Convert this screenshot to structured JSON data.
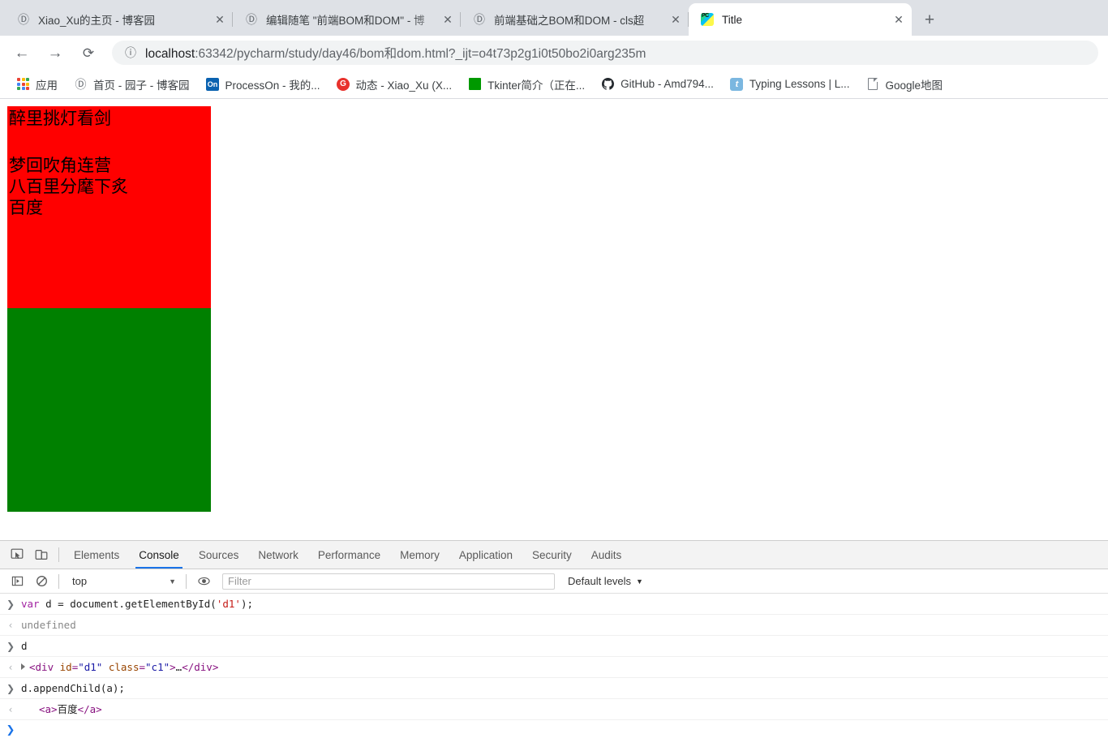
{
  "browser": {
    "tabs": [
      {
        "title": "Xiao_Xu的主页 - 博客园",
        "icon": "blogger-icon",
        "active": false,
        "close_label": "✕"
      },
      {
        "title": "编辑随笔 \"前端BOM和DOM\" - 博",
        "icon": "blogger-icon",
        "active": false,
        "close_label": "✕"
      },
      {
        "title": "前端基础之BOM和DOM - cls超",
        "icon": "blogger-icon",
        "active": false,
        "close_label": "✕"
      },
      {
        "title": "Title",
        "icon": "pycharm-icon",
        "active": true,
        "close_label": "✕"
      }
    ],
    "new_tab_label": "+",
    "nav": {
      "back_label": "←",
      "forward_label": "→",
      "reload_label": "⟳",
      "info_label": "ⓘ"
    },
    "address": {
      "host": "localhost",
      "rest": ":63342/pycharm/study/day46/bom和dom.html?_ijt=o4t73p2g1i0t50bo2i0arg235m",
      "full": "localhost:63342/pycharm/study/day46/bom和dom.html?_ijt=o4t73p2g1i0t50bo2i0arg235m"
    },
    "bookmarks": [
      {
        "label": "应用",
        "icon": "apps-grid-icon"
      },
      {
        "label": "首页 - 园子 - 博客园",
        "icon": "blogger-icon"
      },
      {
        "label": "ProcessOn - 我的...",
        "icon": "processon-icon"
      },
      {
        "label": "动态 - Xiao_Xu (X...",
        "icon": "gitee-icon"
      },
      {
        "label": "Tkinter简介（正在...",
        "icon": "green-square-icon"
      },
      {
        "label": "GitHub - Amd794...",
        "icon": "github-icon"
      },
      {
        "label": "Typing Lessons | L...",
        "icon": "typing-icon"
      },
      {
        "label": "Google地图",
        "icon": "document-icon"
      }
    ]
  },
  "page": {
    "red_div": {
      "id": "d1",
      "class": "c1",
      "color": "#ff0000",
      "title_line": "醉里挑灯看剑",
      "line2": "梦回吹角连营",
      "line3": "八百里分麾下炙",
      "appended_link_text": "百度"
    },
    "green_div": {
      "color": "#008000"
    }
  },
  "devtools": {
    "toolbar_icons": [
      {
        "name": "inspect-element-icon"
      },
      {
        "name": "device-toolbar-icon"
      }
    ],
    "tabs": [
      {
        "label": "Elements",
        "active": false
      },
      {
        "label": "Console",
        "active": true
      },
      {
        "label": "Sources",
        "active": false
      },
      {
        "label": "Network",
        "active": false
      },
      {
        "label": "Performance",
        "active": false
      },
      {
        "label": "Memory",
        "active": false
      },
      {
        "label": "Application",
        "active": false
      },
      {
        "label": "Security",
        "active": false
      },
      {
        "label": "Audits",
        "active": false
      }
    ],
    "filterbar": {
      "sidebar_toggle": "sidebar-toggle-icon",
      "clear_console": "clear-console-icon",
      "context": "top",
      "context_caret": "▼",
      "eye_icon": "live-expression-icon",
      "filter_placeholder": "Filter",
      "filter_value": "",
      "levels_label": "Default levels",
      "levels_caret": "▼"
    },
    "console": {
      "prompt_in": "❯",
      "prompt_out": "‹",
      "messages": [
        {
          "kind": "input",
          "gutter": "❯",
          "tokens": [
            {
              "t": "var ",
              "c": "kw"
            },
            {
              "t": "d = document.getElementById(",
              "c": "plain"
            },
            {
              "t": "'d1'",
              "c": "str"
            },
            {
              "t": ");",
              "c": "plain"
            }
          ]
        },
        {
          "kind": "output",
          "gutter": "‹",
          "tokens": [
            {
              "t": "undefined",
              "c": "gray"
            }
          ]
        },
        {
          "kind": "input",
          "gutter": "❯",
          "tokens": [
            {
              "t": "d",
              "c": "plain"
            }
          ]
        },
        {
          "kind": "output",
          "gutter": "‹",
          "expandable": true,
          "tokens": [
            {
              "t": "<div",
              "c": "tag"
            },
            {
              "t": " id",
              "c": "attr"
            },
            {
              "t": "=",
              "c": "tag"
            },
            {
              "t": "\"d1\"",
              "c": "attrval"
            },
            {
              "t": " class",
              "c": "attr"
            },
            {
              "t": "=",
              "c": "tag"
            },
            {
              "t": "\"c1\"",
              "c": "attrval"
            },
            {
              "t": ">",
              "c": "tag"
            },
            {
              "t": "…",
              "c": "plain"
            },
            {
              "t": "</div>",
              "c": "tag"
            }
          ]
        },
        {
          "kind": "input",
          "gutter": "❯",
          "tokens": [
            {
              "t": "d.appendChild(a);",
              "c": "plain"
            }
          ]
        },
        {
          "kind": "output",
          "gutter": "‹",
          "indent": true,
          "tokens": [
            {
              "t": "<a>",
              "c": "punct"
            },
            {
              "t": "百度",
              "c": "plain"
            },
            {
              "t": "</a>",
              "c": "punct"
            }
          ]
        }
      ],
      "trailing_prompt": "❯"
    }
  },
  "colors": {
    "accent": "#1a73e8",
    "tabstrip_bg": "#dee1e6",
    "omnibox_bg": "#f1f3f4",
    "red": "#ff0000",
    "green": "#008000"
  }
}
